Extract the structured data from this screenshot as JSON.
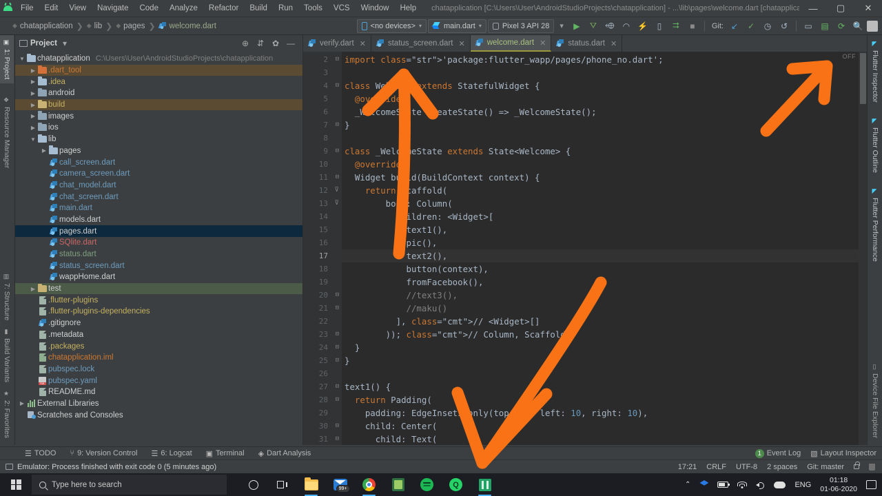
{
  "window": {
    "title": "chatapplication [C:\\Users\\User\\AndroidStudioProjects\\chatapplication] - ...\\lib\\pages\\welcome.dart [chatapplication]",
    "minimize": "—",
    "maximize": "▢",
    "close": "✕"
  },
  "menu": [
    "File",
    "Edit",
    "View",
    "Navigate",
    "Code",
    "Analyze",
    "Refactor",
    "Build",
    "Run",
    "Tools",
    "VCS",
    "Window",
    "Help"
  ],
  "breadcrumbs": [
    {
      "label": "chatapplication",
      "active": false
    },
    {
      "label": "lib",
      "active": false
    },
    {
      "label": "pages",
      "active": false
    },
    {
      "label": "welcome.dart",
      "active": true
    }
  ],
  "toolbar": {
    "device_selector": "<no devices>",
    "run_config": "main.dart",
    "avd": "Pixel 3 API 28",
    "git_label": "Git:",
    "caret": "▾",
    "icons": [
      "run-icon",
      "debug-icon",
      "debug-attach-icon",
      "profile-icon",
      "hot-reload-icon",
      "device-screenshot-icon",
      "apply-changes-icon",
      "stop-icon"
    ],
    "git_icons": [
      "update-project-icon",
      "commit-icon",
      "history-icon",
      "rollback-icon"
    ],
    "right_icons": [
      "avd-manager-icon",
      "sdk-manager-icon",
      "sync-gradle-icon",
      "search-everywhere-icon",
      "profile-avatar-icon"
    ]
  },
  "left_rail": {
    "top": [
      {
        "label": "1: Project",
        "selected": true,
        "icon": "project-icon"
      },
      {
        "label": "Resource Manager",
        "selected": false,
        "icon": "resource-icon"
      }
    ],
    "bottom": [
      {
        "label": "2: Favorites",
        "icon": "star-icon"
      },
      {
        "label": "Build Variants",
        "icon": "variants-icon"
      },
      {
        "label": "7: Structure",
        "icon": "structure-icon"
      }
    ]
  },
  "right_rail": {
    "top": [
      "Flutter Inspector",
      "Flutter Outline",
      "Flutter Performance"
    ],
    "bottom": [
      "Device File Explorer"
    ]
  },
  "project_panel": {
    "title": "Project",
    "caret": "▾",
    "actions": [
      "locate-icon",
      "collapse-all-icon",
      "settings-gear-icon",
      "hide-icon"
    ],
    "tree": [
      {
        "depth": 0,
        "arrow": "▼",
        "icon": "folder-module",
        "label": "chatapplication",
        "sub": "C:\\Users\\User\\AndroidStudioProjects\\chatapplication",
        "color": "white",
        "state": "none"
      },
      {
        "depth": 1,
        "arrow": "▶",
        "icon": "folder-orange",
        "label": ".dart_tool",
        "sub": "",
        "color": "orange",
        "state": "orange"
      },
      {
        "depth": 1,
        "arrow": "▶",
        "icon": "folder-idea",
        "label": ".idea",
        "sub": "",
        "color": "yellow",
        "state": "none"
      },
      {
        "depth": 1,
        "arrow": "▶",
        "icon": "folder",
        "label": "android",
        "sub": "",
        "color": "white",
        "state": "none"
      },
      {
        "depth": 1,
        "arrow": "▶",
        "icon": "folder-build",
        "label": "build",
        "sub": "",
        "color": "yellow",
        "state": "orange"
      },
      {
        "depth": 1,
        "arrow": "▶",
        "icon": "folder",
        "label": "images",
        "sub": "",
        "color": "white",
        "state": "none"
      },
      {
        "depth": 1,
        "arrow": "▶",
        "icon": "folder",
        "label": "ios",
        "sub": "",
        "color": "white",
        "state": "none"
      },
      {
        "depth": 1,
        "arrow": "▼",
        "icon": "folder-lite",
        "label": "lib",
        "sub": "",
        "color": "white",
        "state": "none"
      },
      {
        "depth": 2,
        "arrow": "▶",
        "icon": "folder-lite",
        "label": "pages",
        "sub": "",
        "color": "white",
        "state": "none"
      },
      {
        "depth": 2,
        "arrow": "",
        "icon": "dart-file",
        "label": "call_screen.dart",
        "sub": "",
        "color": "blue",
        "state": "none"
      },
      {
        "depth": 2,
        "arrow": "",
        "icon": "dart-file",
        "label": "camera_screen.dart",
        "sub": "",
        "color": "blue",
        "state": "none"
      },
      {
        "depth": 2,
        "arrow": "",
        "icon": "dart-file",
        "label": "chat_model.dart",
        "sub": "",
        "color": "blue",
        "state": "none"
      },
      {
        "depth": 2,
        "arrow": "",
        "icon": "dart-file",
        "label": "chat_screen.dart",
        "sub": "",
        "color": "blue",
        "state": "none"
      },
      {
        "depth": 2,
        "arrow": "",
        "icon": "dart-file",
        "label": "main.dart",
        "sub": "",
        "color": "blue",
        "state": "none"
      },
      {
        "depth": 2,
        "arrow": "",
        "icon": "dart-file",
        "label": "models.dart",
        "sub": "",
        "color": "white",
        "state": "none"
      },
      {
        "depth": 2,
        "arrow": "",
        "icon": "dart-file",
        "label": "pages.dart",
        "sub": "",
        "color": "white",
        "state": "selected"
      },
      {
        "depth": 2,
        "arrow": "",
        "icon": "dart-file",
        "label": "SQlite.dart",
        "sub": "",
        "color": "red",
        "state": "none"
      },
      {
        "depth": 2,
        "arrow": "",
        "icon": "dart-file",
        "label": "status.dart",
        "sub": "",
        "color": "green",
        "state": "none"
      },
      {
        "depth": 2,
        "arrow": "",
        "icon": "dart-file",
        "label": "status_screen.dart",
        "sub": "",
        "color": "blue",
        "state": "none"
      },
      {
        "depth": 2,
        "arrow": "",
        "icon": "dart-file",
        "label": "wappHome.dart",
        "sub": "",
        "color": "white",
        "state": "none"
      },
      {
        "depth": 1,
        "arrow": "▶",
        "icon": "folder-test",
        "label": "test",
        "sub": "",
        "color": "white",
        "state": "green"
      },
      {
        "depth": 1,
        "arrow": "",
        "icon": "text-file",
        "label": ".flutter-plugins",
        "sub": "",
        "color": "yellow",
        "state": "none"
      },
      {
        "depth": 1,
        "arrow": "",
        "icon": "text-file",
        "label": ".flutter-plugins-dependencies",
        "sub": "",
        "color": "yellow",
        "state": "none"
      },
      {
        "depth": 1,
        "arrow": "",
        "icon": "gitignore-file",
        "label": ".gitignore",
        "sub": "",
        "color": "white",
        "state": "none"
      },
      {
        "depth": 1,
        "arrow": "",
        "icon": "text-file",
        "label": ".metadata",
        "sub": "",
        "color": "white",
        "state": "none"
      },
      {
        "depth": 1,
        "arrow": "",
        "icon": "text-file",
        "label": ".packages",
        "sub": "",
        "color": "yellow",
        "state": "none"
      },
      {
        "depth": 1,
        "arrow": "",
        "icon": "iml-file",
        "label": "chatapplication.iml",
        "sub": "",
        "color": "orange",
        "state": "none"
      },
      {
        "depth": 1,
        "arrow": "",
        "icon": "text-file",
        "label": "pubspec.lock",
        "sub": "",
        "color": "blue",
        "state": "none"
      },
      {
        "depth": 1,
        "arrow": "",
        "icon": "yaml-file",
        "label": "pubspec.yaml",
        "sub": "",
        "color": "blue",
        "state": "none"
      },
      {
        "depth": 1,
        "arrow": "",
        "icon": "text-file",
        "label": "README.md",
        "sub": "",
        "color": "white",
        "state": "none"
      },
      {
        "depth": 0,
        "arrow": "▶",
        "icon": "library-icon",
        "label": "External Libraries",
        "sub": "",
        "color": "white",
        "state": "none"
      },
      {
        "depth": 0,
        "arrow": "",
        "icon": "scratches-icon",
        "label": "Scratches and Consoles",
        "sub": "",
        "color": "white",
        "state": "none"
      }
    ]
  },
  "editor": {
    "tabs": [
      {
        "label": "verify.dart",
        "active": false
      },
      {
        "label": "status_screen.dart",
        "active": false
      },
      {
        "label": "welcome.dart",
        "active": true
      },
      {
        "label": "status.dart",
        "active": false
      }
    ],
    "close_glyph": "✕",
    "inspection_badge": "OFF",
    "current_line": 17,
    "first_line": 2,
    "lines": [
      {
        "n": 2,
        "fold": "⊟",
        "code": "import 'package:flutter_wapp/pages/phone_no.dart';"
      },
      {
        "n": 3,
        "fold": "",
        "code": ""
      },
      {
        "n": 4,
        "fold": "⊟",
        "code": "class Welcome extends StatefulWidget {"
      },
      {
        "n": 5,
        "fold": "",
        "code": "  @override"
      },
      {
        "n": 6,
        "fold": "",
        "code": "  _WelcomeState createState() => _WelcomeState();"
      },
      {
        "n": 7,
        "fold": "⊡",
        "code": "}"
      },
      {
        "n": 8,
        "fold": "",
        "code": ""
      },
      {
        "n": 9,
        "fold": "⊟",
        "code": "class _WelcomeState extends State<Welcome> {"
      },
      {
        "n": 10,
        "fold": "",
        "code": "  @override"
      },
      {
        "n": 11,
        "fold": "⊟",
        "code": "  Widget build(BuildContext context) {"
      },
      {
        "n": 12,
        "fold": "⊽",
        "code": "    return Scaffold("
      },
      {
        "n": 13,
        "fold": "⊽",
        "code": "        body: Column("
      },
      {
        "n": 14,
        "fold": "",
        "code": "          children: <Widget>["
      },
      {
        "n": 15,
        "fold": "",
        "code": "            text1(),"
      },
      {
        "n": 16,
        "fold": "",
        "code": "            pic(),"
      },
      {
        "n": 17,
        "fold": "",
        "code": "            text2(),"
      },
      {
        "n": 18,
        "fold": "",
        "code": "            button(context),"
      },
      {
        "n": 19,
        "fold": "",
        "code": "            fromFacebook(),"
      },
      {
        "n": 20,
        "fold": "⊟",
        "code": "            //text3(),"
      },
      {
        "n": 21,
        "fold": "⊡",
        "code": "            //maku()"
      },
      {
        "n": 22,
        "fold": "",
        "code": "          ], // <Widget>[]"
      },
      {
        "n": 23,
        "fold": "⊡",
        "code": "        )); // Column, Scaffold"
      },
      {
        "n": 24,
        "fold": "⊡",
        "code": "  }"
      },
      {
        "n": 25,
        "fold": "⊡",
        "code": "}"
      },
      {
        "n": 26,
        "fold": "",
        "code": ""
      },
      {
        "n": 27,
        "fold": "⊟",
        "code": "text1() {"
      },
      {
        "n": 28,
        "fold": "⊟",
        "code": "  return Padding("
      },
      {
        "n": 29,
        "fold": "",
        "code": "    padding: EdgeInsets.only(top: 20, left: 10, right: 10),"
      },
      {
        "n": 30,
        "fold": "⊟",
        "code": "    child: Center("
      },
      {
        "n": 31,
        "fold": "⊟",
        "code": "      child: Text("
      }
    ]
  },
  "bottom_bar": {
    "items": [
      {
        "label": "TODO",
        "icon": "todo-icon"
      },
      {
        "label": "9: Version Control",
        "icon": "vcs-icon"
      },
      {
        "label": "6: Logcat",
        "icon": "logcat-icon"
      },
      {
        "label": "Terminal",
        "icon": "terminal-icon"
      },
      {
        "label": "Dart Analysis",
        "icon": "dart-analysis-icon"
      }
    ],
    "event_log": {
      "label": "Event Log",
      "count": "1"
    },
    "layout_inspector": "Layout Inspector"
  },
  "status_bar": {
    "message": "Emulator: Process finished with exit code 0 (5 minutes ago)",
    "time": "17:21",
    "line_sep": "CRLF",
    "encoding": "UTF-8",
    "indent": "2 spaces",
    "branch": "Git: master"
  },
  "taskbar": {
    "search_placeholder": "Type here to search",
    "apps": [
      "cortana-icon",
      "task-view-icon",
      "file-explorer-icon",
      "mail-icon",
      "chrome-icon",
      "notes-icon",
      "spotify-icon",
      "whatsapp-icon",
      "android-studio-icon"
    ],
    "mail_badge": "99+",
    "tray": [
      "show-hidden-icon",
      "dropbox-icon",
      "battery-icon",
      "wifi-icon",
      "volume-icon",
      "onedrive-icon"
    ],
    "language": "ENG",
    "clock_time": "01:18",
    "clock_date": "01-06-2020",
    "chevron": "⌃"
  },
  "annotations": {
    "color": "#f97316",
    "arrows": [
      "up-arrow-pointing-at-class-welcome",
      "up-right-arrow-pointing-at-flutter-inspector",
      "down-arrow-pointing-at-text1-body"
    ]
  }
}
